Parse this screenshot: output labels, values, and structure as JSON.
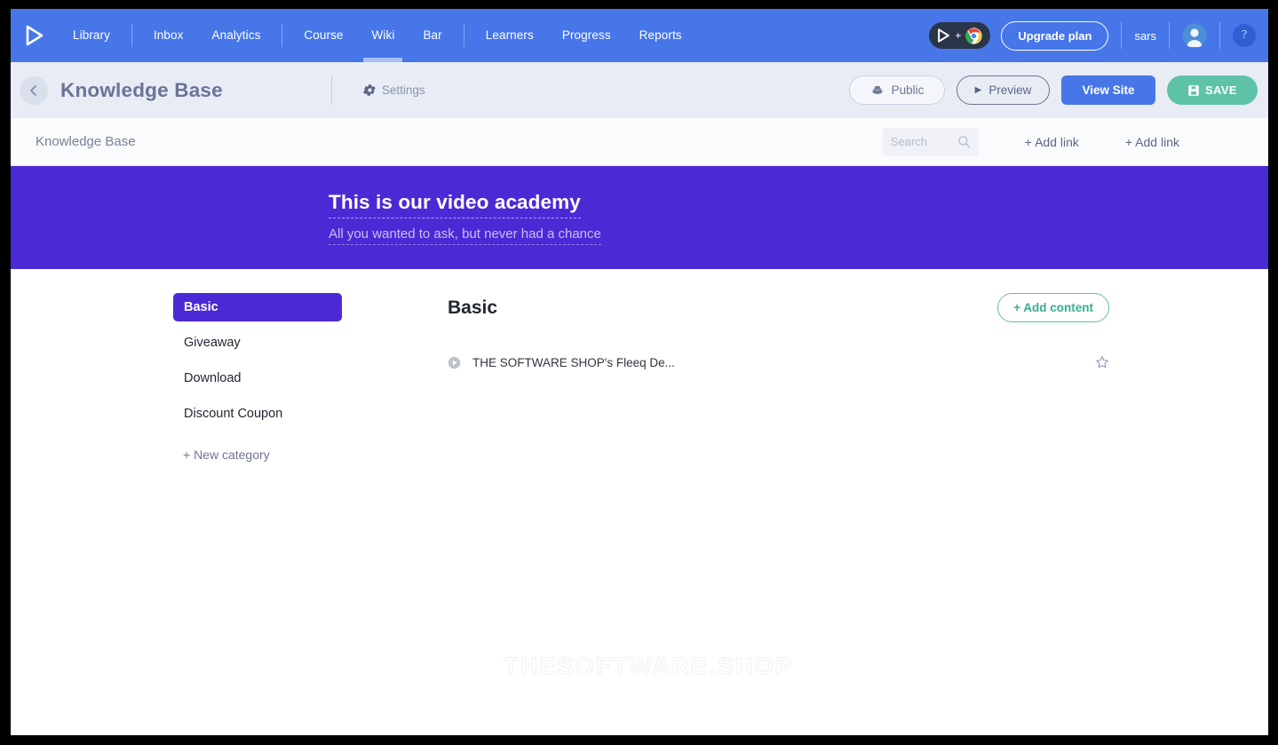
{
  "topnav": {
    "logo_icon": "play-triangle-logo",
    "items": [
      {
        "label": "Library",
        "active": false
      },
      {
        "label": "Inbox",
        "active": false
      },
      {
        "label": "Analytics",
        "active": false
      },
      {
        "label": "Course",
        "active": false
      },
      {
        "label": "Wiki",
        "active": true
      },
      {
        "label": "Bar",
        "active": false
      },
      {
        "label": "Learners",
        "active": false
      },
      {
        "label": "Progress",
        "active": false
      },
      {
        "label": "Reports",
        "active": false
      }
    ],
    "extension_badge": {
      "plus": "+",
      "play_icon": "play-triangle-icon",
      "browser_icon": "chrome-icon"
    },
    "upgrade_label": "Upgrade plan",
    "username": "sars",
    "avatar_icon": "user-avatar-icon",
    "help_label": "?",
    "bg_color": "#4676E8"
  },
  "subheader": {
    "back_icon": "chevron-left-icon",
    "title": "Knowledge Base",
    "settings_label": "Settings",
    "settings_icon": "gear-icon",
    "public_label": "Public",
    "public_icon": "globe-icon",
    "preview_label": "Preview",
    "preview_icon": "play-triangle-icon",
    "view_site_label": "View Site",
    "save_label": "SAVE",
    "save_icon": "floppy-disk-icon",
    "bg_color": "#E8ECF5",
    "save_color": "#5EC2A6",
    "view_site_color": "#4676E8"
  },
  "sitebar": {
    "site_name": "Knowledge Base",
    "search": {
      "value": "",
      "placeholder": "Search",
      "icon": "search-icon"
    },
    "links": [
      {
        "label": "+ Add link"
      },
      {
        "label": "+ Add link"
      }
    ]
  },
  "hero": {
    "title": "This is our video academy",
    "subtitle": "All you wanted to ask, but never had a chance",
    "bg_color": "#4B2AD6"
  },
  "sidebar": {
    "categories": [
      {
        "label": "Basic",
        "active": true
      },
      {
        "label": "Giveaway",
        "active": false
      },
      {
        "label": "Download",
        "active": false
      },
      {
        "label": "Discount Coupon",
        "active": false
      }
    ],
    "new_category_label": "+ New category",
    "active_color": "#4B2AD6"
  },
  "main": {
    "title": "Basic",
    "add_content_label": "+ Add content",
    "add_content_color": "#5EC2A6",
    "items": [
      {
        "label": "THE SOFTWARE SHOP's Fleeq De...",
        "icon": "play-circle-icon",
        "star_icon": "star-outline-icon"
      }
    ],
    "watermark": "THESOFTWARE.SHOP"
  }
}
